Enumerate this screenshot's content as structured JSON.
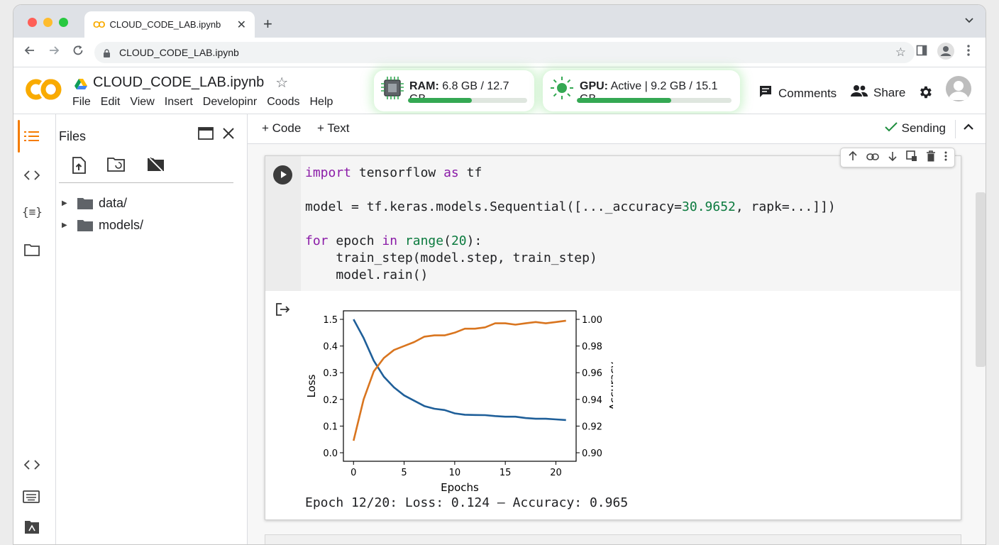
{
  "browser": {
    "tab_title": "CLOUD_CODE_LAB.ipynb",
    "tab_logo": "CO",
    "close_glyph": "✕",
    "new_tab_glyph": "+",
    "address": "CLOUD_CODE_LAB.ipynb"
  },
  "colab": {
    "notebook_title": "CLOUD_CODE_LAB.ipynb",
    "menu": [
      "File",
      "Edit",
      "View",
      "Insert",
      "Developinr",
      "Coods",
      "Help"
    ],
    "ram": {
      "label": "RAM:",
      "value": "6.8 GB / 12.7 GB",
      "fraction": 0.535
    },
    "gpu": {
      "label": "GPU:",
      "value": "Active | 9.2 GB / 15.1 GB",
      "fraction": 0.61
    },
    "comments_label": "Comments",
    "share_label": "Share"
  },
  "files_panel": {
    "title": "Files",
    "items": [
      {
        "name": "data/"
      },
      {
        "name": "models/"
      }
    ]
  },
  "toolbar": {
    "code_label": "+ Code",
    "text_label": "+ Text",
    "status": "Sending"
  },
  "cell": {
    "output_text": "Epoch 12/20: Loss: 0.124 – Accuracy: 0.965"
  },
  "chart_data": {
    "type": "line",
    "xlabel": "Epochs",
    "ylabel": "Loss",
    "y2label": "Accuracy",
    "x_ticks": [
      0,
      5,
      10,
      15,
      20
    ],
    "y_ticks": [
      "0.0",
      "0.1",
      "0.2",
      "0.3",
      "0.4",
      "1.5"
    ],
    "y2_ticks": [
      "0.90",
      "0.92",
      "0.94",
      "0.96",
      "0.98",
      "1.00"
    ],
    "xlim": [
      -1,
      22
    ],
    "y2lim": [
      0.9,
      1.0
    ],
    "series": [
      {
        "axis": "left",
        "color": "#1f5f99",
        "x": [
          0,
          1,
          2,
          3,
          4,
          5,
          6,
          7,
          8,
          9,
          10,
          11,
          12,
          13,
          14,
          15,
          16,
          17,
          18,
          19,
          20,
          21
        ],
        "y_norm": [
          1.0,
          0.86,
          0.69,
          0.57,
          0.49,
          0.43,
          0.39,
          0.35,
          0.33,
          0.32,
          0.295,
          0.285,
          0.283,
          0.282,
          0.275,
          0.27,
          0.27,
          0.26,
          0.255,
          0.255,
          0.25,
          0.245
        ]
      },
      {
        "axis": "right",
        "color": "#d9751f",
        "x": [
          0,
          1,
          2,
          3,
          4,
          5,
          6,
          7,
          8,
          9,
          10,
          11,
          12,
          13,
          14,
          15,
          16,
          17,
          18,
          19,
          20,
          21
        ],
        "y": [
          0.909,
          0.94,
          0.961,
          0.971,
          0.977,
          0.98,
          0.983,
          0.987,
          0.988,
          0.988,
          0.99,
          0.993,
          0.993,
          0.994,
          0.997,
          0.997,
          0.996,
          0.997,
          0.998,
          0.997,
          0.998,
          0.999
        ]
      }
    ]
  }
}
